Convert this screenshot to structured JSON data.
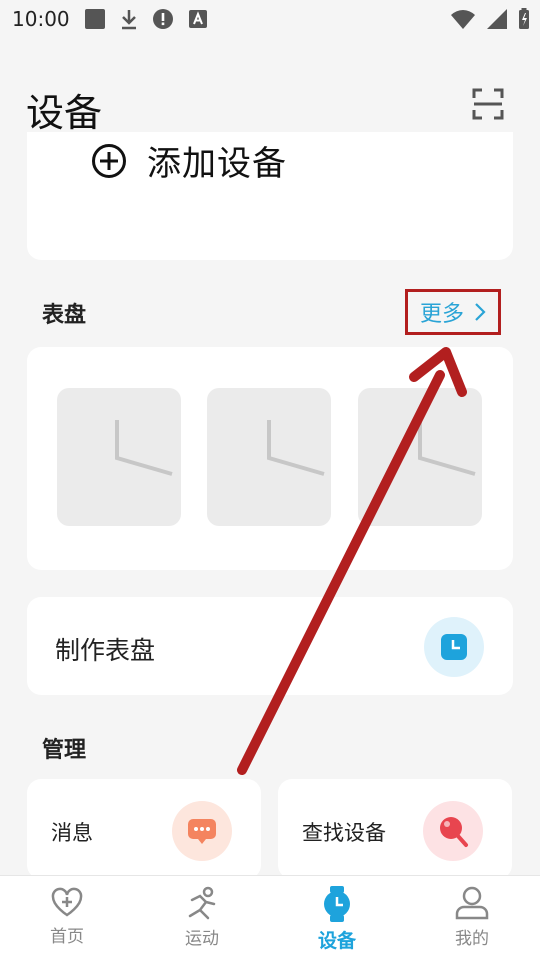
{
  "status_bar": {
    "time": "10:00"
  },
  "header": {
    "title": "设备"
  },
  "add_device": {
    "label": "添加设备"
  },
  "watch_faces": {
    "title": "表盘",
    "more_label": "更多"
  },
  "make_face": {
    "label": "制作表盘"
  },
  "manage": {
    "title": "管理",
    "items": [
      {
        "label": "消息"
      },
      {
        "label": "查找设备"
      }
    ]
  },
  "tabs": [
    {
      "label": "首页"
    },
    {
      "label": "运动"
    },
    {
      "label": "设备"
    },
    {
      "label": "我的"
    }
  ],
  "colors": {
    "accent": "#1ea3dc",
    "annotation": "#b21f1f",
    "message_icon": "#f4845f",
    "search_icon": "#e8454f"
  }
}
